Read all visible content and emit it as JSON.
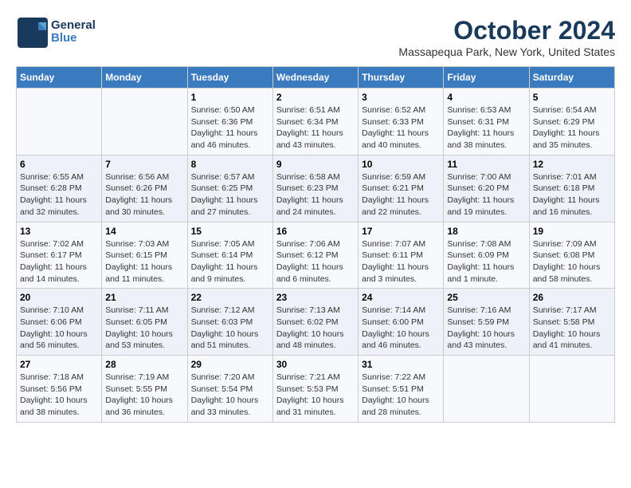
{
  "header": {
    "logo_text_top": "General",
    "logo_text_bottom": "Blue",
    "month": "October 2024",
    "location": "Massapequa Park, New York, United States"
  },
  "days_of_week": [
    "Sunday",
    "Monday",
    "Tuesday",
    "Wednesday",
    "Thursday",
    "Friday",
    "Saturday"
  ],
  "weeks": [
    [
      {
        "day": "",
        "sunrise": "",
        "sunset": "",
        "daylight": ""
      },
      {
        "day": "",
        "sunrise": "",
        "sunset": "",
        "daylight": ""
      },
      {
        "day": "1",
        "sunrise": "Sunrise: 6:50 AM",
        "sunset": "Sunset: 6:36 PM",
        "daylight": "Daylight: 11 hours and 46 minutes."
      },
      {
        "day": "2",
        "sunrise": "Sunrise: 6:51 AM",
        "sunset": "Sunset: 6:34 PM",
        "daylight": "Daylight: 11 hours and 43 minutes."
      },
      {
        "day": "3",
        "sunrise": "Sunrise: 6:52 AM",
        "sunset": "Sunset: 6:33 PM",
        "daylight": "Daylight: 11 hours and 40 minutes."
      },
      {
        "day": "4",
        "sunrise": "Sunrise: 6:53 AM",
        "sunset": "Sunset: 6:31 PM",
        "daylight": "Daylight: 11 hours and 38 minutes."
      },
      {
        "day": "5",
        "sunrise": "Sunrise: 6:54 AM",
        "sunset": "Sunset: 6:29 PM",
        "daylight": "Daylight: 11 hours and 35 minutes."
      }
    ],
    [
      {
        "day": "6",
        "sunrise": "Sunrise: 6:55 AM",
        "sunset": "Sunset: 6:28 PM",
        "daylight": "Daylight: 11 hours and 32 minutes."
      },
      {
        "day": "7",
        "sunrise": "Sunrise: 6:56 AM",
        "sunset": "Sunset: 6:26 PM",
        "daylight": "Daylight: 11 hours and 30 minutes."
      },
      {
        "day": "8",
        "sunrise": "Sunrise: 6:57 AM",
        "sunset": "Sunset: 6:25 PM",
        "daylight": "Daylight: 11 hours and 27 minutes."
      },
      {
        "day": "9",
        "sunrise": "Sunrise: 6:58 AM",
        "sunset": "Sunset: 6:23 PM",
        "daylight": "Daylight: 11 hours and 24 minutes."
      },
      {
        "day": "10",
        "sunrise": "Sunrise: 6:59 AM",
        "sunset": "Sunset: 6:21 PM",
        "daylight": "Daylight: 11 hours and 22 minutes."
      },
      {
        "day": "11",
        "sunrise": "Sunrise: 7:00 AM",
        "sunset": "Sunset: 6:20 PM",
        "daylight": "Daylight: 11 hours and 19 minutes."
      },
      {
        "day": "12",
        "sunrise": "Sunrise: 7:01 AM",
        "sunset": "Sunset: 6:18 PM",
        "daylight": "Daylight: 11 hours and 16 minutes."
      }
    ],
    [
      {
        "day": "13",
        "sunrise": "Sunrise: 7:02 AM",
        "sunset": "Sunset: 6:17 PM",
        "daylight": "Daylight: 11 hours and 14 minutes."
      },
      {
        "day": "14",
        "sunrise": "Sunrise: 7:03 AM",
        "sunset": "Sunset: 6:15 PM",
        "daylight": "Daylight: 11 hours and 11 minutes."
      },
      {
        "day": "15",
        "sunrise": "Sunrise: 7:05 AM",
        "sunset": "Sunset: 6:14 PM",
        "daylight": "Daylight: 11 hours and 9 minutes."
      },
      {
        "day": "16",
        "sunrise": "Sunrise: 7:06 AM",
        "sunset": "Sunset: 6:12 PM",
        "daylight": "Daylight: 11 hours and 6 minutes."
      },
      {
        "day": "17",
        "sunrise": "Sunrise: 7:07 AM",
        "sunset": "Sunset: 6:11 PM",
        "daylight": "Daylight: 11 hours and 3 minutes."
      },
      {
        "day": "18",
        "sunrise": "Sunrise: 7:08 AM",
        "sunset": "Sunset: 6:09 PM",
        "daylight": "Daylight: 11 hours and 1 minute."
      },
      {
        "day": "19",
        "sunrise": "Sunrise: 7:09 AM",
        "sunset": "Sunset: 6:08 PM",
        "daylight": "Daylight: 10 hours and 58 minutes."
      }
    ],
    [
      {
        "day": "20",
        "sunrise": "Sunrise: 7:10 AM",
        "sunset": "Sunset: 6:06 PM",
        "daylight": "Daylight: 10 hours and 56 minutes."
      },
      {
        "day": "21",
        "sunrise": "Sunrise: 7:11 AM",
        "sunset": "Sunset: 6:05 PM",
        "daylight": "Daylight: 10 hours and 53 minutes."
      },
      {
        "day": "22",
        "sunrise": "Sunrise: 7:12 AM",
        "sunset": "Sunset: 6:03 PM",
        "daylight": "Daylight: 10 hours and 51 minutes."
      },
      {
        "day": "23",
        "sunrise": "Sunrise: 7:13 AM",
        "sunset": "Sunset: 6:02 PM",
        "daylight": "Daylight: 10 hours and 48 minutes."
      },
      {
        "day": "24",
        "sunrise": "Sunrise: 7:14 AM",
        "sunset": "Sunset: 6:00 PM",
        "daylight": "Daylight: 10 hours and 46 minutes."
      },
      {
        "day": "25",
        "sunrise": "Sunrise: 7:16 AM",
        "sunset": "Sunset: 5:59 PM",
        "daylight": "Daylight: 10 hours and 43 minutes."
      },
      {
        "day": "26",
        "sunrise": "Sunrise: 7:17 AM",
        "sunset": "Sunset: 5:58 PM",
        "daylight": "Daylight: 10 hours and 41 minutes."
      }
    ],
    [
      {
        "day": "27",
        "sunrise": "Sunrise: 7:18 AM",
        "sunset": "Sunset: 5:56 PM",
        "daylight": "Daylight: 10 hours and 38 minutes."
      },
      {
        "day": "28",
        "sunrise": "Sunrise: 7:19 AM",
        "sunset": "Sunset: 5:55 PM",
        "daylight": "Daylight: 10 hours and 36 minutes."
      },
      {
        "day": "29",
        "sunrise": "Sunrise: 7:20 AM",
        "sunset": "Sunset: 5:54 PM",
        "daylight": "Daylight: 10 hours and 33 minutes."
      },
      {
        "day": "30",
        "sunrise": "Sunrise: 7:21 AM",
        "sunset": "Sunset: 5:53 PM",
        "daylight": "Daylight: 10 hours and 31 minutes."
      },
      {
        "day": "31",
        "sunrise": "Sunrise: 7:22 AM",
        "sunset": "Sunset: 5:51 PM",
        "daylight": "Daylight: 10 hours and 28 minutes."
      },
      {
        "day": "",
        "sunrise": "",
        "sunset": "",
        "daylight": ""
      },
      {
        "day": "",
        "sunrise": "",
        "sunset": "",
        "daylight": ""
      }
    ]
  ]
}
